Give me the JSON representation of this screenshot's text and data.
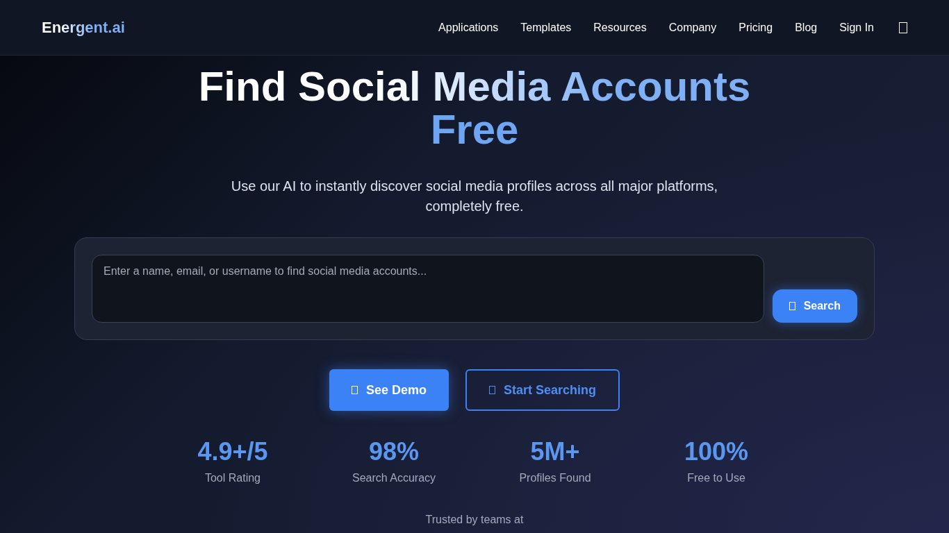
{
  "header": {
    "logo": "Energent.ai",
    "nav": [
      {
        "label": "Applications"
      },
      {
        "label": "Templates"
      },
      {
        "label": "Resources"
      },
      {
        "label": "Company"
      },
      {
        "label": "Pricing"
      },
      {
        "label": "Blog"
      },
      {
        "label": "Sign In"
      }
    ]
  },
  "hero": {
    "title_line_1": "Find Social Media Accounts",
    "title_line_2": "Free",
    "subtitle": "Use our AI to instantly discover social media profiles across all major platforms, completely free."
  },
  "search": {
    "placeholder": "Enter a name, email, or username to find social media accounts...",
    "button": "Search"
  },
  "actions": [
    {
      "label": "See Demo",
      "kind": "primary"
    },
    {
      "label": "Start Searching",
      "kind": "outline"
    }
  ],
  "stats": [
    {
      "value": "4.9+/5",
      "label": "Tool Rating"
    },
    {
      "value": "98%",
      "label": "Search Accuracy"
    },
    {
      "value": "5M+",
      "label": "Profiles Found"
    },
    {
      "value": "100%",
      "label": "Free to Use"
    }
  ],
  "trusted": "Trusted by teams at"
}
